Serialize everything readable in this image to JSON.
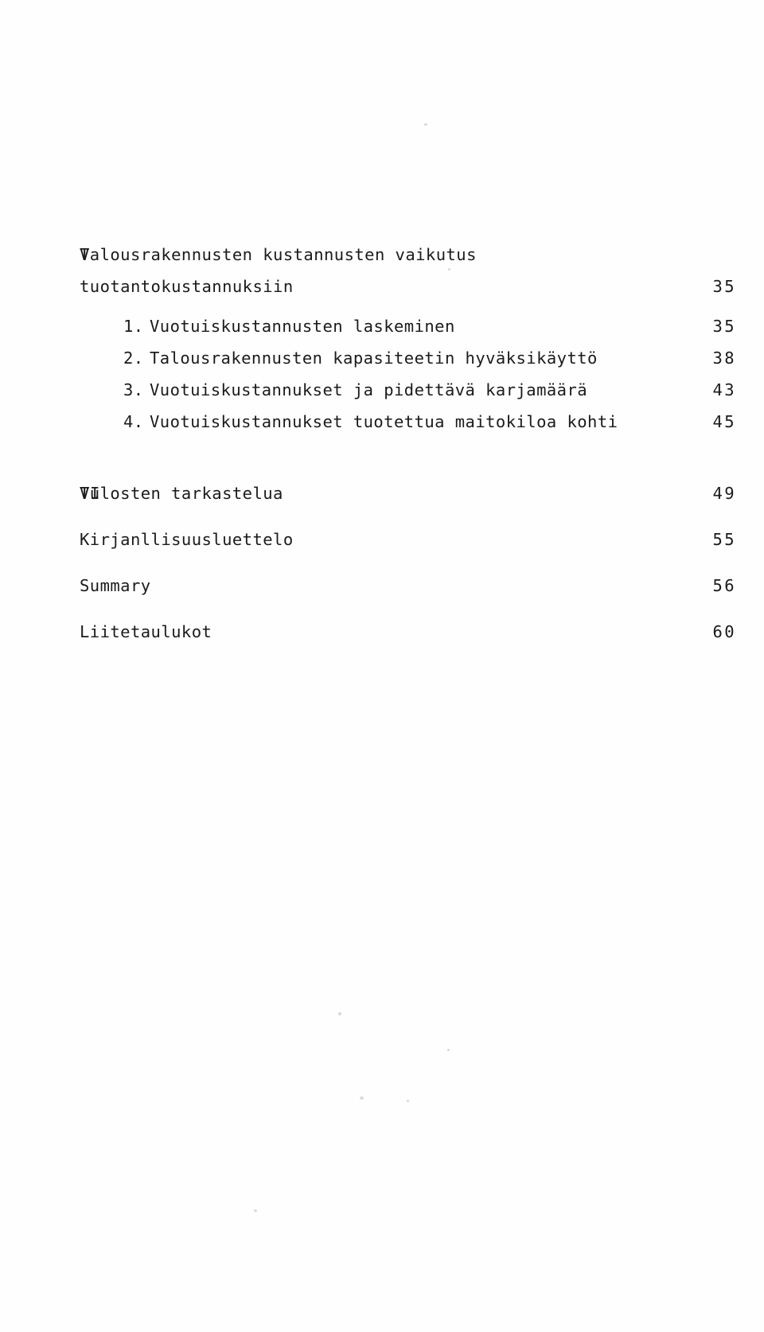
{
  "document": {
    "type": "table-of-contents",
    "language": "fi"
  },
  "toc": {
    "entries": [
      {
        "numeral": "V",
        "lines": [
          "Talousrakennusten kustannusten vaikutus",
          "tuotantokustannuksiin"
        ],
        "page": "35"
      },
      {
        "numeral": "VI",
        "lines": [
          "Tulosten tarkastelua"
        ],
        "page": "49"
      }
    ],
    "subitems": [
      {
        "marker": "1.",
        "text": "Vuotuiskustannusten laskeminen",
        "page": "35"
      },
      {
        "marker": "2.",
        "text": "Talousrakennusten kapasiteetin hyväksikäyttö",
        "page": "38"
      },
      {
        "marker": "3.",
        "text": "Vuotuiskustannukset ja pidettävä karjamäärä",
        "page": "43"
      },
      {
        "marker": "4.",
        "text": "Vuotuiskustannukset tuotettua maitokiloa kohti",
        "page": "45"
      }
    ],
    "backmatter": [
      {
        "text": "Kirjanllisuusluettelo",
        "page": "55"
      },
      {
        "text": "Summary",
        "page": "56"
      },
      {
        "text": "Liitetaulukot",
        "page": "60"
      }
    ]
  },
  "colors": {
    "paper": "#fefefe",
    "ink": "#1b1b1b",
    "speck": "#b9b9b9"
  }
}
